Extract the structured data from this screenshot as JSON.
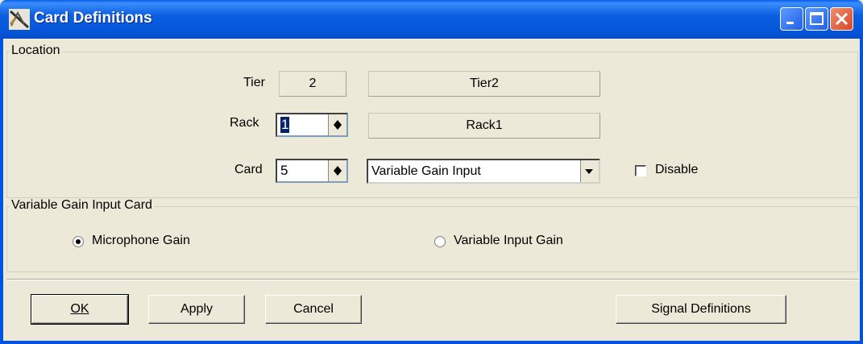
{
  "window": {
    "title": "Card Definitions",
    "controls": [
      "minimize-icon",
      "maximize-icon",
      "close-icon"
    ]
  },
  "location": {
    "group_title": "Location",
    "tier": {
      "label": "Tier",
      "value": "2",
      "name": "Tier2"
    },
    "rack": {
      "label": "Rack",
      "value": "1",
      "name": "Rack1"
    },
    "card": {
      "label": "Card",
      "value": "5",
      "type": "Variable Gain Input"
    },
    "disable": {
      "label": "Disable",
      "checked": false
    }
  },
  "input_card": {
    "group_title": "Variable Gain Input Card",
    "options": [
      {
        "label": "Microphone Gain",
        "selected": true
      },
      {
        "label": "Variable Input Gain",
        "selected": false
      }
    ]
  },
  "buttons": {
    "ok_label": "OK",
    "apply_label": "Apply",
    "cancel_label": "Cancel",
    "signal_label": "Signal Definitions"
  }
}
